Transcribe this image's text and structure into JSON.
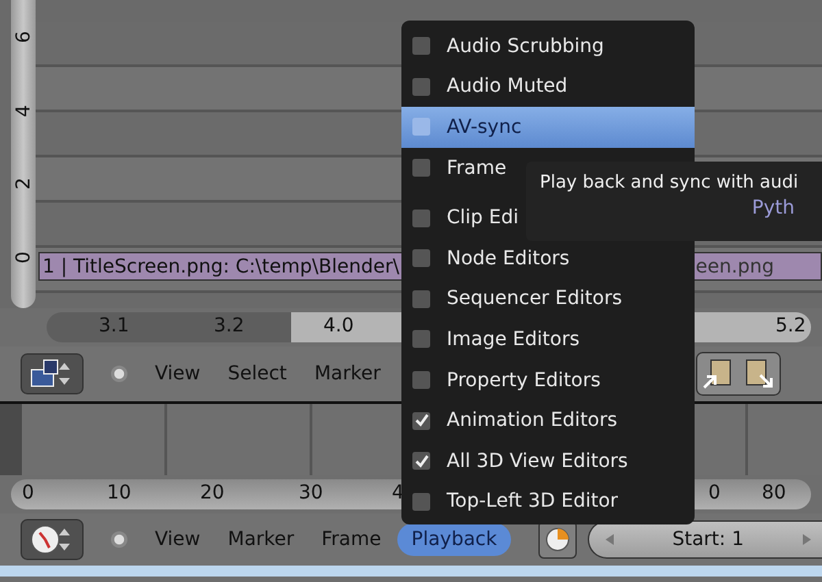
{
  "sequencer": {
    "y_axis_labels": [
      "6",
      "4",
      "2",
      "0"
    ],
    "strip": {
      "label": "1 | TitleScreen.png: C:\\temp\\Blender\\",
      "tail": "een.png"
    },
    "ruler_labels": [
      "3.1",
      "3.2",
      "4.0",
      "5.2"
    ]
  },
  "sequencer_header": {
    "menus": [
      "View",
      "Select",
      "Marker"
    ]
  },
  "timeline": {
    "ruler_labels": [
      "0",
      "10",
      "20",
      "30",
      "4",
      "0",
      "80"
    ]
  },
  "timeline_header": {
    "menus": [
      {
        "label": "View",
        "selected": false
      },
      {
        "label": "Marker",
        "selected": false
      },
      {
        "label": "Frame",
        "selected": false
      },
      {
        "label": "Playback",
        "selected": true
      }
    ],
    "start_field": "Start: 1"
  },
  "playback_menu": {
    "groups": [
      [
        {
          "label": "Audio Scrubbing",
          "checked": false,
          "selected": false
        },
        {
          "label": "Audio Muted",
          "checked": false,
          "selected": false
        },
        {
          "label": "AV-sync",
          "checked": false,
          "selected": true
        },
        {
          "label": "Frame",
          "checked": false,
          "selected": false
        }
      ],
      [
        {
          "label": "Clip Edi",
          "checked": false,
          "selected": false
        },
        {
          "label": "Node Editors",
          "checked": false,
          "selected": false
        },
        {
          "label": "Sequencer Editors",
          "checked": false,
          "selected": false
        },
        {
          "label": "Image Editors",
          "checked": false,
          "selected": false
        },
        {
          "label": "Property Editors",
          "checked": false,
          "selected": false
        },
        {
          "label": "Animation Editors",
          "checked": true,
          "selected": false
        },
        {
          "label": "All 3D View Editors",
          "checked": true,
          "selected": false
        },
        {
          "label": "Top-Left 3D Editor",
          "checked": false,
          "selected": false
        }
      ]
    ]
  },
  "tooltip": {
    "text": "Play back and sync with audi",
    "python": "Pyth"
  }
}
